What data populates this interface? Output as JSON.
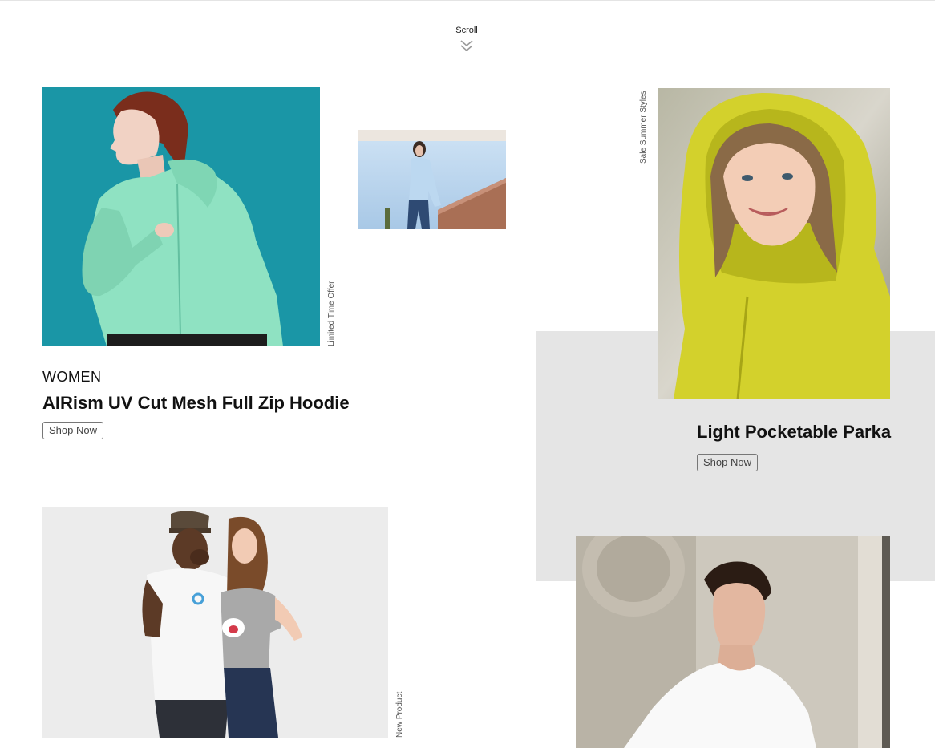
{
  "scroll": {
    "label": "Scroll",
    "icon": "double-chevron-down-icon"
  },
  "colors": {
    "panel_grey": "#e5e5e5",
    "teal": "#1a96a6",
    "parka_yellow": "#d3d12c"
  },
  "feature_hoodie": {
    "category": "WOMEN",
    "title": "AIRism UV Cut Mesh Full Zip Hoodie",
    "button": "Shop Now",
    "side_label": "Limited Time Offer"
  },
  "feature_parka": {
    "title": "Light Pocketable Parka",
    "button": "Shop Now",
    "side_label": "Sale Summer Styles"
  },
  "feature_tees": {
    "side_label": "New Product"
  },
  "photos": {
    "hoodie_main": "woman in mint zip hoodie on teal background",
    "hoodie_small": "woman in light blue zip hoodie outdoors",
    "parka": "girl in yellow hooded parka",
    "tees": "couple in graphic t-shirts",
    "men_tee": "man in white t-shirt"
  }
}
